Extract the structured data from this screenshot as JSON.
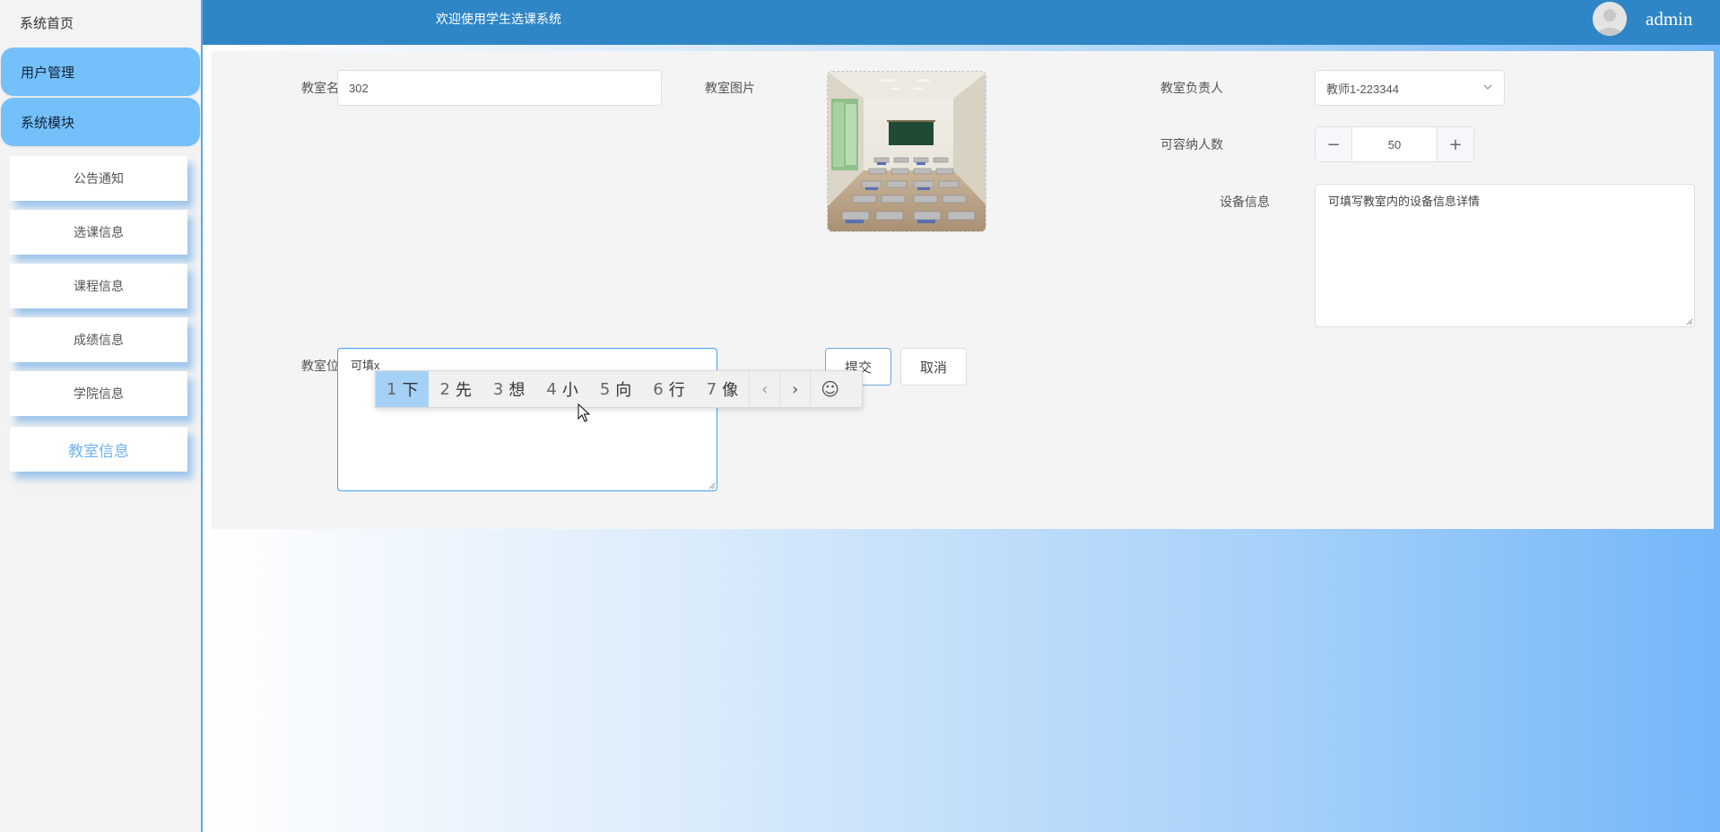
{
  "sidebar": {
    "home": "系统首页",
    "groups": [
      "用户管理",
      "系统模块"
    ],
    "items": [
      "公告通知",
      "选课信息",
      "课程信息",
      "成绩信息",
      "学院信息",
      "教室信息"
    ]
  },
  "header": {
    "welcome": "欢迎使用学生选课系统",
    "username": "admin"
  },
  "form": {
    "name_label": "教室名称",
    "name_value": "302",
    "image_label": "教室图片",
    "owner_label": "教室负责人",
    "owner_value": "教师1-223344",
    "capacity_label": "可容纳人数",
    "capacity_value": "50",
    "capacity_minus": "−",
    "capacity_plus": "+",
    "equipment_label": "设备信息",
    "equipment_value": "可填写教室内的设备信息详情",
    "location_label": "教室位置",
    "location_value": "可填x",
    "submit": "提交",
    "cancel": "取消"
  },
  "ime": {
    "candidates": [
      {
        "num": "1",
        "char": "下"
      },
      {
        "num": "2",
        "char": "先"
      },
      {
        "num": "3",
        "char": "想"
      },
      {
        "num": "4",
        "char": "小"
      },
      {
        "num": "5",
        "char": "向"
      },
      {
        "num": "6",
        "char": "行"
      },
      {
        "num": "7",
        "char": "像"
      }
    ],
    "prev": "‹",
    "next": "›",
    "emoji": "☺"
  },
  "icons": {
    "dropdown": "chevron-down-icon",
    "avatar": "user-avatar-icon"
  }
}
